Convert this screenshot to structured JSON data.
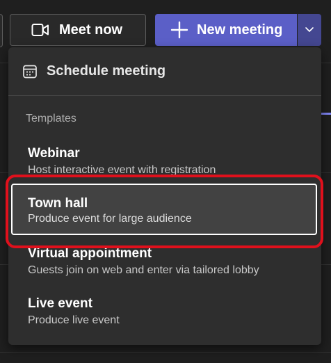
{
  "toolbar": {
    "meet_now_label": "Meet now",
    "meet_now_icon": "video-camera-icon",
    "new_meeting_label": "New meeting",
    "new_meeting_icon": "plus-icon",
    "dropdown_icon": "chevron-down-icon"
  },
  "menu": {
    "schedule_label": "Schedule meeting",
    "schedule_icon": "calendar-icon",
    "section_title": "Templates",
    "items": [
      {
        "title": "Webinar",
        "description": "Host interactive event with registration"
      },
      {
        "title": "Town hall",
        "description": "Produce event for large audience",
        "selected": true
      },
      {
        "title": "Virtual appointment",
        "description": "Guests join on web and enter via tailored lobby"
      },
      {
        "title": "Live event",
        "description": "Produce live event"
      }
    ]
  },
  "colors": {
    "background": "#1f1f1f",
    "menu_background": "#2e2e2e",
    "primary_button": "#5b5fc7",
    "primary_split": "#444791",
    "selected_item": "#424242",
    "annotation": "#e0101c"
  }
}
